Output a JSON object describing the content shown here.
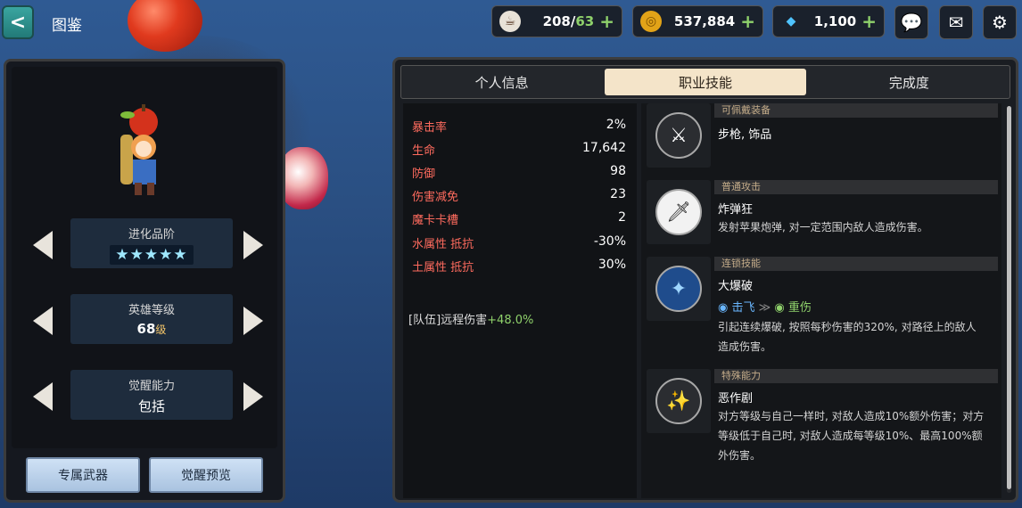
{
  "header": {
    "title": "图鉴",
    "back_label": "<",
    "stamina": {
      "current": "208",
      "max": "63"
    },
    "gold": "537,884",
    "gems": "1,100",
    "plus": "+"
  },
  "left": {
    "evolution_label": "进化品阶",
    "evolution_stars": "★★★★★",
    "level_label": "英雄等级",
    "level_value": "68",
    "level_unit": "级",
    "awaken_label": "觉醒能力",
    "awaken_value": "包括",
    "btn_weapon": "专属武器",
    "btn_awaken_preview": "觉醒预览"
  },
  "tabs": [
    "个人信息",
    "职业技能",
    "完成度"
  ],
  "active_tab": 1,
  "stats": [
    {
      "name": "暴击率",
      "value": "2%"
    },
    {
      "name": "生命",
      "value": "17,642"
    },
    {
      "name": "防御",
      "value": "98"
    },
    {
      "name": "伤害减免",
      "value": "23"
    },
    {
      "name": "魔卡卡槽",
      "value": "2"
    },
    {
      "name": "水属性  抵抗",
      "value": "-30%"
    },
    {
      "name": "土属性  抵抗",
      "value": "30%"
    }
  ],
  "team_bonus": {
    "label": "[队伍]远程伤害",
    "value": "+48.0%"
  },
  "skills": [
    {
      "header": "可佩戴装备",
      "title": "步枪, 饰品",
      "desc": ""
    },
    {
      "header": "普通攻击",
      "title": "炸弹狂",
      "desc": "发射苹果炮弹, 对一定范围内敌人造成伤害。"
    },
    {
      "header": "连锁技能",
      "title": "大爆破",
      "tag1": "击飞",
      "tag_sep": "≫",
      "tag2": "重伤",
      "desc": "引起连续爆破, 按照每秒伤害的320%, 对路径上的敌人造成伤害。"
    },
    {
      "header": "特殊能力",
      "title": "恶作剧",
      "desc": "对方等级与自己一样时, 对敌人造成10%额外伤害；对方等级低于自己时, 对敌人造成每等级10%、最高100%额外伤害。"
    }
  ],
  "colors": {
    "stat_name": "#ff6b5e",
    "bonus": "#8fd16b",
    "tab_active": "#f4e4c9",
    "skill_header": "#c4ac8a"
  }
}
